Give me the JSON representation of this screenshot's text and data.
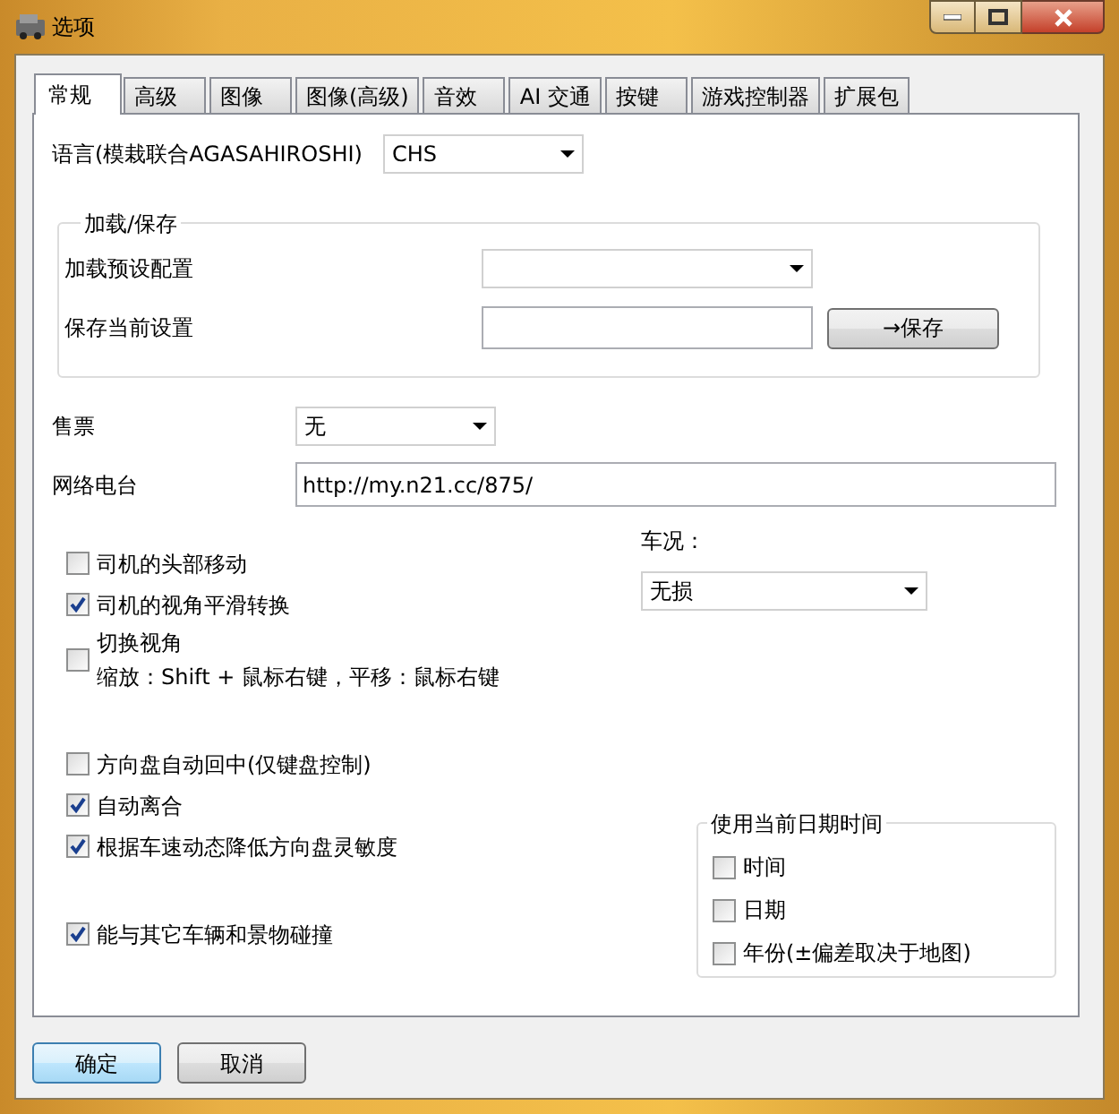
{
  "window": {
    "title": "选项"
  },
  "tabs": [
    {
      "label": "常规",
      "selected": true
    },
    {
      "label": "高级",
      "selected": false
    },
    {
      "label": "图像",
      "selected": false
    },
    {
      "label": "图像(高级)",
      "selected": false
    },
    {
      "label": "音效",
      "selected": false
    },
    {
      "label": "AI 交通",
      "selected": false
    },
    {
      "label": "按键",
      "selected": false
    },
    {
      "label": "游戏控制器",
      "selected": false
    },
    {
      "label": "扩展包",
      "selected": false
    }
  ],
  "language": {
    "label": "语言(模栽联合AGASAHIROSHI)",
    "value": "CHS"
  },
  "load_save": {
    "title": "加载/保存",
    "preset_label": "加载预设配置",
    "save_label": "保存当前设置",
    "save_button": "→保存"
  },
  "ticket": {
    "label": "售票",
    "value": "无"
  },
  "radio": {
    "label": "网络电台",
    "value": "http://my.n21.cc/875/"
  },
  "option_groups": [
    {
      "options": [
        {
          "label": "司机的头部移动",
          "checked": false
        },
        {
          "label": "司机的视角平滑转换",
          "checked": true
        },
        {
          "label": "切换视角",
          "hint": "缩放：Shift + 鼠标右键，平移：鼠标右键",
          "checked": false
        }
      ]
    },
    {
      "options": [
        {
          "label": "方向盘自动回中(仅键盘控制)",
          "checked": false
        },
        {
          "label": "自动离合",
          "checked": true
        },
        {
          "label": "根据车速动态降低方向盘灵敏度",
          "checked": true
        }
      ]
    },
    {
      "options": [
        {
          "label": "能与其它车辆和景物碰撞",
          "checked": true
        }
      ]
    }
  ],
  "condition": {
    "label": "车况：",
    "value": "无损"
  },
  "date_time": {
    "title": "使用当前日期时间",
    "options": [
      {
        "label": "时间",
        "checked": false
      },
      {
        "label": "日期",
        "checked": false
      },
      {
        "label": "年份(±偏差取决于地图)",
        "checked": false
      }
    ]
  },
  "buttons": [
    {
      "label": "确定",
      "default": true
    },
    {
      "label": "取消",
      "default": false
    }
  ]
}
